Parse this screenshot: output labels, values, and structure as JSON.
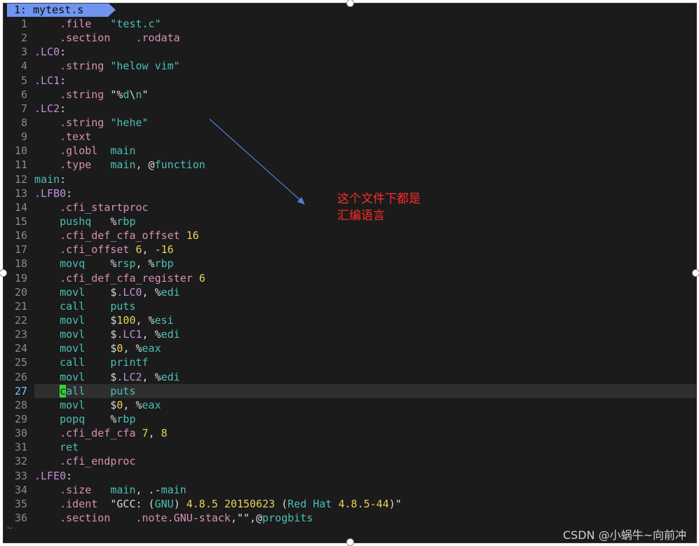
{
  "tab": {
    "label": "1: mytest.s"
  },
  "lines": [
    {
      "n": "1",
      "tokens": [
        {
          "t": "    "
        },
        {
          "t": ".file",
          "c": "dir"
        },
        {
          "t": "   "
        },
        {
          "t": "\"test.c\"",
          "c": "str"
        }
      ]
    },
    {
      "n": "2",
      "tokens": [
        {
          "t": "    "
        },
        {
          "t": ".section",
          "c": "dir"
        },
        {
          "t": "    "
        },
        {
          "t": ".rodata",
          "c": "dir"
        }
      ]
    },
    {
      "n": "3",
      "tokens": [
        {
          "t": ".LC0",
          "c": "lbl"
        },
        {
          "t": ":"
        }
      ]
    },
    {
      "n": "4",
      "tokens": [
        {
          "t": "    "
        },
        {
          "t": ".string",
          "c": "dir"
        },
        {
          "t": " "
        },
        {
          "t": "\"helow vim\"",
          "c": "str"
        }
      ]
    },
    {
      "n": "5",
      "tokens": [
        {
          "t": ".LC1",
          "c": "lbl"
        },
        {
          "t": ":"
        }
      ]
    },
    {
      "n": "6",
      "tokens": [
        {
          "t": "    "
        },
        {
          "t": ".string",
          "c": "dir"
        },
        {
          "t": " \"%",
          "c": "plain"
        },
        {
          "t": "d",
          "c": "esc"
        },
        {
          "t": "\\",
          "c": "plain"
        },
        {
          "t": "n",
          "c": "esc"
        },
        {
          "t": "\"",
          "c": "plain"
        }
      ]
    },
    {
      "n": "7",
      "tokens": [
        {
          "t": ".LC2",
          "c": "lbl"
        },
        {
          "t": ":"
        }
      ]
    },
    {
      "n": "8",
      "tokens": [
        {
          "t": "    "
        },
        {
          "t": ".string",
          "c": "dir"
        },
        {
          "t": " "
        },
        {
          "t": "\"hehe\"",
          "c": "str"
        }
      ]
    },
    {
      "n": "9",
      "tokens": [
        {
          "t": "    "
        },
        {
          "t": ".text",
          "c": "dir"
        }
      ]
    },
    {
      "n": "10",
      "tokens": [
        {
          "t": "    "
        },
        {
          "t": ".globl",
          "c": "dir"
        },
        {
          "t": "  "
        },
        {
          "t": "main",
          "c": "sym"
        }
      ]
    },
    {
      "n": "11",
      "tokens": [
        {
          "t": "    "
        },
        {
          "t": ".type",
          "c": "dir"
        },
        {
          "t": "   "
        },
        {
          "t": "main",
          "c": "sym"
        },
        {
          "t": ", @"
        },
        {
          "t": "function",
          "c": "sym"
        }
      ]
    },
    {
      "n": "12",
      "tokens": [
        {
          "t": "main",
          "c": "sym"
        },
        {
          "t": ":"
        }
      ]
    },
    {
      "n": "13",
      "tokens": [
        {
          "t": ".LFB0",
          "c": "lbl"
        },
        {
          "t": ":"
        }
      ]
    },
    {
      "n": "14",
      "tokens": [
        {
          "t": "    "
        },
        {
          "t": ".cfi_startproc",
          "c": "dir"
        }
      ]
    },
    {
      "n": "15",
      "tokens": [
        {
          "t": "    "
        },
        {
          "t": "pushq",
          "c": "op"
        },
        {
          "t": "   %"
        },
        {
          "t": "rbp",
          "c": "sym"
        }
      ]
    },
    {
      "n": "16",
      "tokens": [
        {
          "t": "    "
        },
        {
          "t": ".cfi_def_cfa_offset",
          "c": "dir"
        },
        {
          "t": " "
        },
        {
          "t": "16",
          "c": "num"
        }
      ]
    },
    {
      "n": "17",
      "tokens": [
        {
          "t": "    "
        },
        {
          "t": ".cfi_offset",
          "c": "dir"
        },
        {
          "t": " "
        },
        {
          "t": "6",
          "c": "num"
        },
        {
          "t": ", "
        },
        {
          "t": "-16",
          "c": "num"
        }
      ]
    },
    {
      "n": "18",
      "tokens": [
        {
          "t": "    "
        },
        {
          "t": "movq",
          "c": "op"
        },
        {
          "t": "    %"
        },
        {
          "t": "rsp",
          "c": "sym"
        },
        {
          "t": ", %"
        },
        {
          "t": "rbp",
          "c": "sym"
        }
      ]
    },
    {
      "n": "19",
      "tokens": [
        {
          "t": "    "
        },
        {
          "t": ".cfi_def_cfa_register",
          "c": "dir"
        },
        {
          "t": " "
        },
        {
          "t": "6",
          "c": "num"
        }
      ]
    },
    {
      "n": "20",
      "tokens": [
        {
          "t": "    "
        },
        {
          "t": "movl",
          "c": "op"
        },
        {
          "t": "    $"
        },
        {
          "t": ".LC0",
          "c": "lbl"
        },
        {
          "t": ", %"
        },
        {
          "t": "edi",
          "c": "sym"
        }
      ]
    },
    {
      "n": "21",
      "tokens": [
        {
          "t": "    "
        },
        {
          "t": "call",
          "c": "op"
        },
        {
          "t": "    "
        },
        {
          "t": "puts",
          "c": "sym"
        }
      ]
    },
    {
      "n": "22",
      "tokens": [
        {
          "t": "    "
        },
        {
          "t": "movl",
          "c": "op"
        },
        {
          "t": "    $"
        },
        {
          "t": "100",
          "c": "num"
        },
        {
          "t": ", %"
        },
        {
          "t": "esi",
          "c": "sym"
        }
      ]
    },
    {
      "n": "23",
      "tokens": [
        {
          "t": "    "
        },
        {
          "t": "movl",
          "c": "op"
        },
        {
          "t": "    $"
        },
        {
          "t": ".LC1",
          "c": "lbl"
        },
        {
          "t": ", %"
        },
        {
          "t": "edi",
          "c": "sym"
        }
      ]
    },
    {
      "n": "24",
      "tokens": [
        {
          "t": "    "
        },
        {
          "t": "movl",
          "c": "op"
        },
        {
          "t": "    $"
        },
        {
          "t": "0",
          "c": "num"
        },
        {
          "t": ", %"
        },
        {
          "t": "eax",
          "c": "sym"
        }
      ]
    },
    {
      "n": "25",
      "tokens": [
        {
          "t": "    "
        },
        {
          "t": "call",
          "c": "op"
        },
        {
          "t": "    "
        },
        {
          "t": "printf",
          "c": "sym"
        }
      ]
    },
    {
      "n": "26",
      "tokens": [
        {
          "t": "    "
        },
        {
          "t": "movl",
          "c": "op"
        },
        {
          "t": "    $"
        },
        {
          "t": ".LC2",
          "c": "lbl"
        },
        {
          "t": ", %"
        },
        {
          "t": "edi",
          "c": "sym"
        }
      ]
    },
    {
      "n": "27",
      "cur": true,
      "tokens": [
        {
          "t": "    "
        },
        {
          "t": "c",
          "c": "cursor"
        },
        {
          "t": "all",
          "c": "op"
        },
        {
          "t": "    "
        },
        {
          "t": "puts",
          "c": "sym"
        }
      ]
    },
    {
      "n": "28",
      "tokens": [
        {
          "t": "    "
        },
        {
          "t": "movl",
          "c": "op"
        },
        {
          "t": "    $"
        },
        {
          "t": "0",
          "c": "num"
        },
        {
          "t": ", %"
        },
        {
          "t": "eax",
          "c": "sym"
        }
      ]
    },
    {
      "n": "29",
      "tokens": [
        {
          "t": "    "
        },
        {
          "t": "popq",
          "c": "op"
        },
        {
          "t": "    %"
        },
        {
          "t": "rbp",
          "c": "sym"
        }
      ]
    },
    {
      "n": "30",
      "tokens": [
        {
          "t": "    "
        },
        {
          "t": ".cfi_def_cfa",
          "c": "dir"
        },
        {
          "t": " "
        },
        {
          "t": "7",
          "c": "num"
        },
        {
          "t": ", "
        },
        {
          "t": "8",
          "c": "num"
        }
      ]
    },
    {
      "n": "31",
      "tokens": [
        {
          "t": "    "
        },
        {
          "t": "ret",
          "c": "op"
        }
      ]
    },
    {
      "n": "32",
      "tokens": [
        {
          "t": "    "
        },
        {
          "t": ".cfi_endproc",
          "c": "dir"
        }
      ]
    },
    {
      "n": "33",
      "tokens": [
        {
          "t": ".LFE0",
          "c": "lbl"
        },
        {
          "t": ":"
        }
      ]
    },
    {
      "n": "34",
      "tokens": [
        {
          "t": "    "
        },
        {
          "t": ".size",
          "c": "dir"
        },
        {
          "t": "   "
        },
        {
          "t": "main",
          "c": "sym"
        },
        {
          "t": ", .-"
        },
        {
          "t": "main",
          "c": "sym"
        }
      ]
    },
    {
      "n": "35",
      "tokens": [
        {
          "t": "    "
        },
        {
          "t": ".ident",
          "c": "dir"
        },
        {
          "t": "  \"GCC: ("
        },
        {
          "t": "GNU",
          "c": "sym"
        },
        {
          "t": ") "
        },
        {
          "t": "4.8.5",
          "c": "num"
        },
        {
          "t": " "
        },
        {
          "t": "20150623",
          "c": "num"
        },
        {
          "t": " ("
        },
        {
          "t": "Red Hat",
          "c": "sym"
        },
        {
          "t": " "
        },
        {
          "t": "4.8.5-44",
          "c": "num"
        },
        {
          "t": ")\""
        }
      ]
    },
    {
      "n": "36",
      "tokens": [
        {
          "t": "    "
        },
        {
          "t": ".section",
          "c": "dir"
        },
        {
          "t": "    "
        },
        {
          "t": ".note.GNU-stack",
          "c": "dir"
        },
        {
          "t": ",\"\",@"
        },
        {
          "t": "progbits",
          "c": "sym"
        }
      ]
    }
  ],
  "tilde": "~",
  "annotation": {
    "line1": "这个文件下都是",
    "line2": "汇编语言",
    "color": "#ff2a2a"
  },
  "watermark": "CSDN @小蜗牛~向前冲",
  "colors": {
    "background": "#1b1b1b",
    "tab": "#6f95f0",
    "directive": "#d98fb6",
    "string": "#4cbfb6",
    "number": "#e8d25a",
    "cursor": "#35d235"
  }
}
